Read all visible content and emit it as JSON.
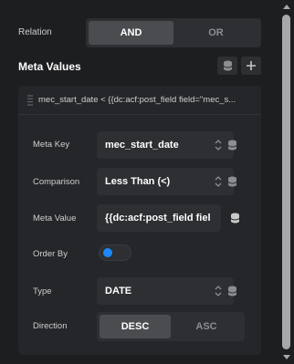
{
  "relation": {
    "label": "Relation",
    "options": [
      "AND",
      "OR"
    ],
    "selected": "AND"
  },
  "meta_values": {
    "title": "Meta Values",
    "item": {
      "title": "mec_start_date < {{dc:acf:post_field field=\"mec_s...",
      "meta_key": {
        "label": "Meta Key",
        "value": "mec_start_date"
      },
      "comparison": {
        "label": "Comparison",
        "value": "Less Than (<)"
      },
      "meta_value": {
        "label": "Meta Value",
        "value": "{{dc:acf:post_field fiel"
      },
      "order_by": {
        "label": "Order By",
        "enabled": true
      },
      "type": {
        "label": "Type",
        "value": "DATE"
      },
      "direction": {
        "label": "Direction",
        "options": [
          "DESC",
          "ASC"
        ],
        "selected": "DESC"
      }
    }
  },
  "colors": {
    "accent": "#1e88ff",
    "background": "#1d1e20",
    "field": "#2e2f32"
  }
}
